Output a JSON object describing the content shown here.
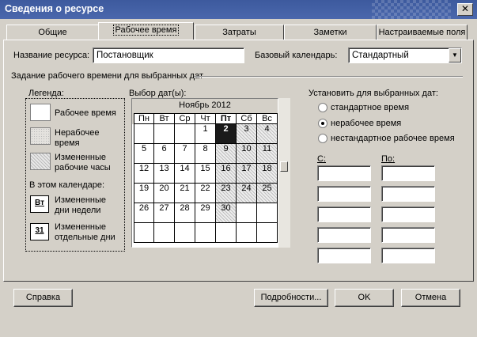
{
  "window": {
    "title": "Сведения о ресурсе",
    "close_label": "✕"
  },
  "tabs": [
    {
      "label": "Общие",
      "active": false
    },
    {
      "label": "Рабочее время",
      "active": true
    },
    {
      "label": "Затраты",
      "active": false
    },
    {
      "label": "Заметки",
      "active": false
    },
    {
      "label": "Настраиваемые поля",
      "active": false
    }
  ],
  "form": {
    "resource_name_label": "Название ресурса:",
    "resource_name_value": "Постановщик",
    "base_calendar_label": "Базовый календарь:",
    "base_calendar_value": "Стандартный"
  },
  "group_title": "Задание рабочего времени для выбранных дат",
  "legend": {
    "title": "Легенда:",
    "items": [
      {
        "label": "Рабочее время",
        "kind": "working"
      },
      {
        "label": "Нерабочее время",
        "kind": "nonworking"
      },
      {
        "label": "Измененные рабочие часы",
        "kind": "edited"
      }
    ],
    "in_calendar_title": "В этом календаре:",
    "calendar_items": [
      {
        "icon_text": "Вт",
        "label": "Измененные дни недели"
      },
      {
        "icon_text": "31",
        "label": "Измененные отдельные дни"
      }
    ]
  },
  "calendar": {
    "label": "Выбор дат(ы):",
    "month": "Ноябрь 2012",
    "weekdays": [
      "Пн",
      "Вт",
      "Ср",
      "Чт",
      "Пт",
      "Сб",
      "Вс"
    ],
    "selected_weekday": "Пт",
    "selected_day": "2",
    "days": [
      [
        "",
        "",
        "",
        "1",
        "2",
        "3",
        "4"
      ],
      [
        "5",
        "6",
        "7",
        "8",
        "9",
        "10",
        "11"
      ],
      [
        "12",
        "13",
        "14",
        "15",
        "16",
        "17",
        "18"
      ],
      [
        "19",
        "20",
        "21",
        "22",
        "23",
        "24",
        "25"
      ],
      [
        "26",
        "27",
        "28",
        "29",
        "30",
        "",
        ""
      ],
      [
        "",
        "",
        "",
        "",
        "",
        "",
        ""
      ]
    ],
    "nonworking_days": [
      "3",
      "4",
      "9",
      "10",
      "11",
      "16",
      "17",
      "18",
      "23",
      "24",
      "25",
      "30"
    ]
  },
  "set_for_dates": {
    "title": "Установить для выбранных дат:",
    "options": [
      {
        "label": "стандартное время",
        "checked": false
      },
      {
        "label": "нерабочее время",
        "checked": true
      },
      {
        "label": "нестандартное рабочее время",
        "checked": false
      }
    ],
    "from_label": "С:",
    "to_label": "По:",
    "rows": [
      {
        "from": "",
        "to": ""
      },
      {
        "from": "",
        "to": ""
      },
      {
        "from": "",
        "to": ""
      },
      {
        "from": "",
        "to": ""
      },
      {
        "from": "",
        "to": ""
      }
    ]
  },
  "buttons": {
    "help": "Справка",
    "details": "Подробности...",
    "ok": "OK",
    "cancel": "Отмена"
  },
  "colors": {
    "titlebar": "#3d5a9e",
    "dialog_bg": "#d4d0c8",
    "selected_day": "#1a1a1a"
  }
}
